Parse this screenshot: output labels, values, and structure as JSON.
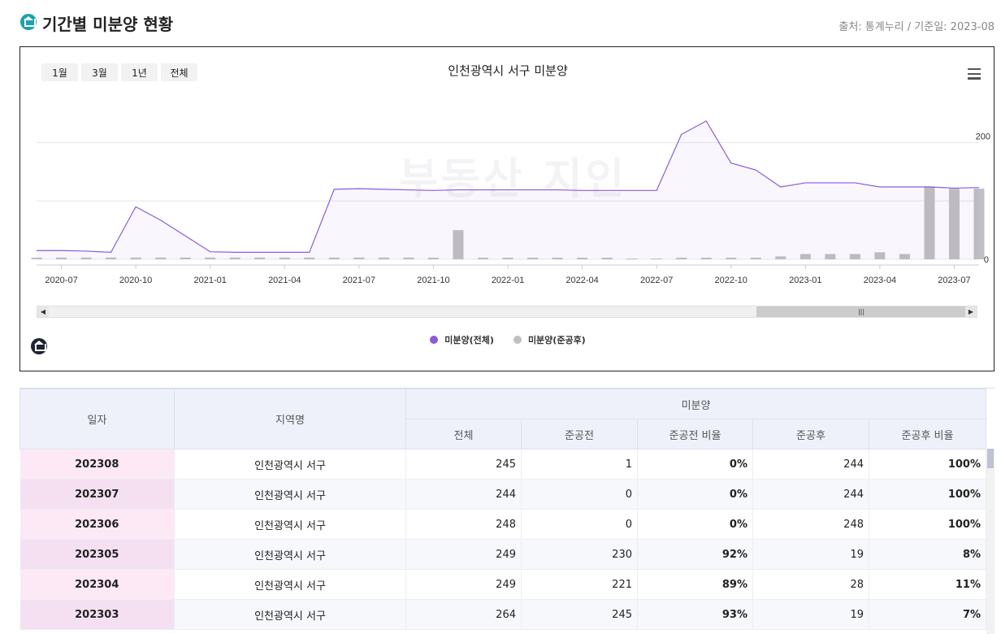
{
  "header": {
    "title": "기간별 미분양 현황",
    "source": "출처: 통계누리 / 기준일: 2023-08"
  },
  "chart": {
    "range_buttons": [
      "1월",
      "3월",
      "1년",
      "전체"
    ],
    "watermark": "부동산 지인"
  },
  "chart_data": {
    "type": "line",
    "title": "인천광역시 서구 미분양",
    "x": [
      "2020-06",
      "2020-07",
      "2020-08",
      "2020-09",
      "2020-10",
      "2020-11",
      "2020-12",
      "2021-01",
      "2021-02",
      "2021-03",
      "2021-04",
      "2021-05",
      "2021-06",
      "2021-07",
      "2021-08",
      "2021-09",
      "2021-10",
      "2021-11",
      "2021-12",
      "2022-01",
      "2022-02",
      "2022-03",
      "2022-04",
      "2022-05",
      "2022-06",
      "2022-07",
      "2022-08",
      "2022-09",
      "2022-10",
      "2022-11",
      "2022-12",
      "2023-01",
      "2023-02",
      "2023-03",
      "2023-04",
      "2023-05",
      "2023-06",
      "2023-07",
      "2023-08"
    ],
    "series": [
      {
        "name": "미분양(전체)",
        "kind": "line-area",
        "color": "#8a5bd8",
        "values": [
          15,
          15,
          14,
          12,
          90,
          67,
          40,
          13,
          12,
          12,
          12,
          12,
          120,
          121,
          120,
          119,
          118,
          119,
          119,
          119,
          119,
          119,
          118,
          118,
          118,
          118,
          214,
          237,
          165,
          153,
          124,
          131,
          131,
          131,
          124,
          124,
          124,
          122,
          123
        ]
      },
      {
        "name": "미분양(준공후)",
        "kind": "bar",
        "color": "#c0c0c0",
        "values": [
          3,
          3,
          3,
          3,
          3,
          3,
          3,
          3,
          3,
          3,
          3,
          3,
          3,
          3,
          3,
          3,
          2,
          50,
          1,
          1,
          1,
          1,
          1,
          1,
          0,
          0,
          1,
          1,
          1,
          1,
          5,
          9,
          9,
          9,
          12,
          9,
          125,
          121,
          121
        ]
      }
    ],
    "x_tick_labels": [
      "2020-07",
      "2020-10",
      "2021-01",
      "2021-04",
      "2021-07",
      "2021-10",
      "2022-01",
      "2022-04",
      "2022-07",
      "2022-10",
      "2023-01",
      "2023-04",
      "2023-07"
    ],
    "y_tick_labels": [
      "0",
      "200"
    ],
    "ylim": [
      0,
      280
    ],
    "grid": true,
    "legend": "bottom-center"
  },
  "table": {
    "headers": {
      "date": "일자",
      "region": "지역명",
      "group": "미분양",
      "total": "전체",
      "pre": "준공전",
      "pre_ratio": "준공전 비율",
      "post": "준공후",
      "post_ratio": "준공후 비율"
    },
    "rows": [
      {
        "date": "202308",
        "region": "인천광역시 서구",
        "total": "245",
        "pre": "1",
        "pre_ratio": "0%",
        "post": "244",
        "post_ratio": "100%"
      },
      {
        "date": "202307",
        "region": "인천광역시 서구",
        "total": "244",
        "pre": "0",
        "pre_ratio": "0%",
        "post": "244",
        "post_ratio": "100%"
      },
      {
        "date": "202306",
        "region": "인천광역시 서구",
        "total": "248",
        "pre": "0",
        "pre_ratio": "0%",
        "post": "248",
        "post_ratio": "100%"
      },
      {
        "date": "202305",
        "region": "인천광역시 서구",
        "total": "249",
        "pre": "230",
        "pre_ratio": "92%",
        "post": "19",
        "post_ratio": "8%"
      },
      {
        "date": "202304",
        "region": "인천광역시 서구",
        "total": "249",
        "pre": "221",
        "pre_ratio": "89%",
        "post": "28",
        "post_ratio": "11%"
      },
      {
        "date": "202303",
        "region": "인천광역시 서구",
        "total": "264",
        "pre": "245",
        "pre_ratio": "93%",
        "post": "19",
        "post_ratio": "7%"
      }
    ]
  }
}
